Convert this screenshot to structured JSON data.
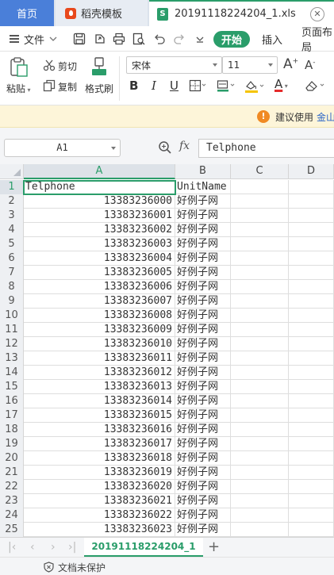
{
  "tabs": {
    "home": "首页",
    "template": "稻壳模板",
    "file": "20191118224204_1.xls",
    "file_icon": "S"
  },
  "menu": {
    "file": "文件",
    "start": "开始",
    "insert": "插入",
    "page_layout": "页面布局"
  },
  "ribbon": {
    "paste": "粘贴",
    "cut": "剪切",
    "copy": "复制",
    "format_painter": "格式刷",
    "font_name": "宋体",
    "font_size": "11",
    "bold": "B",
    "italic": "I",
    "underline": "U",
    "font_color_letter": "A"
  },
  "notice": {
    "text": "建议使用",
    "link": "金山"
  },
  "formula": {
    "cell_ref": "A1",
    "fx": "fx",
    "value": "Telphone"
  },
  "grid": {
    "columns": [
      "A",
      "B",
      "C",
      "D"
    ],
    "rows": [
      {
        "n": "1",
        "a": "Telphone",
        "b": "UnitName"
      },
      {
        "n": "2",
        "a": "13383236000",
        "b": "好例子网"
      },
      {
        "n": "3",
        "a": "13383236001",
        "b": "好例子网"
      },
      {
        "n": "4",
        "a": "13383236002",
        "b": "好例子网"
      },
      {
        "n": "5",
        "a": "13383236003",
        "b": "好例子网"
      },
      {
        "n": "6",
        "a": "13383236004",
        "b": "好例子网"
      },
      {
        "n": "7",
        "a": "13383236005",
        "b": "好例子网"
      },
      {
        "n": "8",
        "a": "13383236006",
        "b": "好例子网"
      },
      {
        "n": "9",
        "a": "13383236007",
        "b": "好例子网"
      },
      {
        "n": "10",
        "a": "13383236008",
        "b": "好例子网"
      },
      {
        "n": "11",
        "a": "13383236009",
        "b": "好例子网"
      },
      {
        "n": "12",
        "a": "13383236010",
        "b": "好例子网"
      },
      {
        "n": "13",
        "a": "13383236011",
        "b": "好例子网"
      },
      {
        "n": "14",
        "a": "13383236012",
        "b": "好例子网"
      },
      {
        "n": "15",
        "a": "13383236013",
        "b": "好例子网"
      },
      {
        "n": "16",
        "a": "13383236014",
        "b": "好例子网"
      },
      {
        "n": "17",
        "a": "13383236015",
        "b": "好例子网"
      },
      {
        "n": "18",
        "a": "13383236016",
        "b": "好例子网"
      },
      {
        "n": "19",
        "a": "13383236017",
        "b": "好例子网"
      },
      {
        "n": "20",
        "a": "13383236018",
        "b": "好例子网"
      },
      {
        "n": "21",
        "a": "13383236019",
        "b": "好例子网"
      },
      {
        "n": "22",
        "a": "13383236020",
        "b": "好例子网"
      },
      {
        "n": "23",
        "a": "13383236021",
        "b": "好例子网"
      },
      {
        "n": "24",
        "a": "13383236022",
        "b": "好例子网"
      },
      {
        "n": "25",
        "a": "13383236023",
        "b": "好例子网"
      }
    ]
  },
  "sheets": {
    "active": "20191118224204_1",
    "add": "+"
  },
  "status": {
    "protection": "文档未保护"
  },
  "colors": {
    "accent_green": "#2a9d6a",
    "tab_blue": "#4a7fd9",
    "template_red": "#e8481c",
    "warning_orange": "#f08a24"
  }
}
